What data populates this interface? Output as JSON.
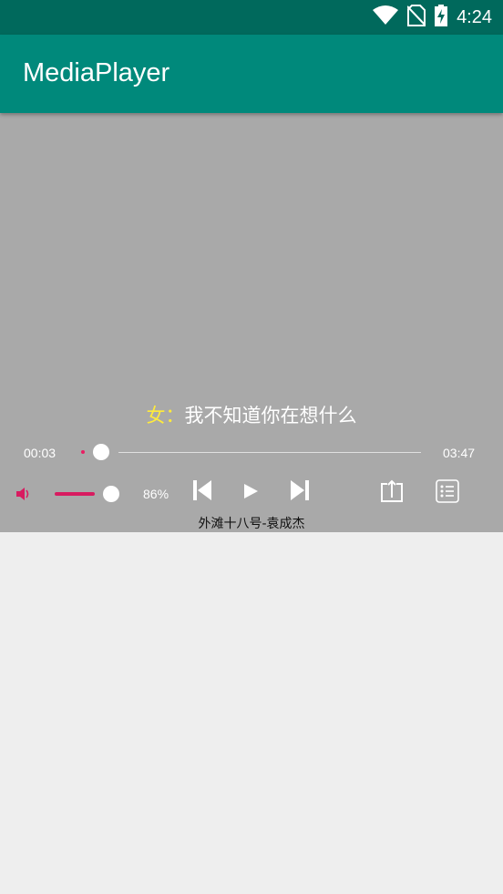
{
  "status_bar": {
    "time": "4:24",
    "icons": [
      "wifi-icon",
      "no-sim-icon",
      "battery-charging-icon"
    ]
  },
  "app_bar": {
    "title": "MediaPlayer"
  },
  "player": {
    "lyric": {
      "speaker": "女：",
      "text": "我不知道你在想什么"
    },
    "current_time": "00:03",
    "total_time": "03:47",
    "progress_fraction": 0.013,
    "volume_percent_label": "86%",
    "volume_fraction": 0.86,
    "song_title": "外滩十八号-袁成杰",
    "controls": [
      "volume-icon",
      "previous-icon",
      "play-icon",
      "next-icon",
      "share-icon",
      "playlist-icon"
    ]
  },
  "colors": {
    "status_bar": "#00695c",
    "app_bar": "#00897b",
    "player_bg": "#a9a9a9",
    "accent": "#d81b60",
    "speaker": "#ffeb3b",
    "page_bg": "#eeeeee"
  }
}
